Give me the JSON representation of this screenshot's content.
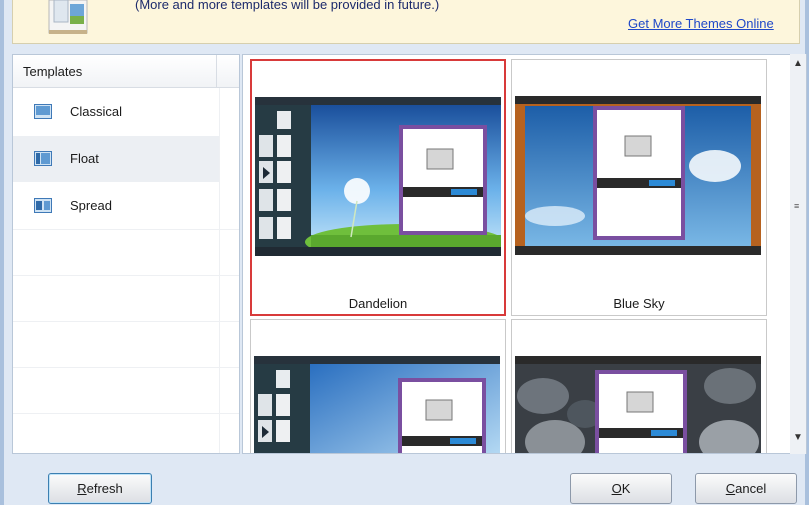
{
  "banner": {
    "text": "(More and more templates will be provided in future.)",
    "link": "Get More Themes Online"
  },
  "templates_panel": {
    "header": "Templates",
    "items": [
      {
        "label": "Classical",
        "icon": "classical-layout-icon"
      },
      {
        "label": "Float",
        "icon": "float-layout-icon",
        "selected": true
      },
      {
        "label": "Spread",
        "icon": "spread-layout-icon"
      }
    ]
  },
  "gallery": {
    "themes": [
      {
        "name": "Dandelion",
        "selected": true
      },
      {
        "name": "Blue Sky"
      }
    ]
  },
  "buttons": {
    "refresh": {
      "first": "R",
      "rest": "efresh"
    },
    "ok": {
      "first": "O",
      "rest": "K"
    },
    "cancel": {
      "first": "C",
      "rest": "ancel"
    }
  },
  "colors": {
    "selection_border": "#d83a3a",
    "link": "#1f48c8",
    "banner_bg": "#fdf6dc"
  }
}
